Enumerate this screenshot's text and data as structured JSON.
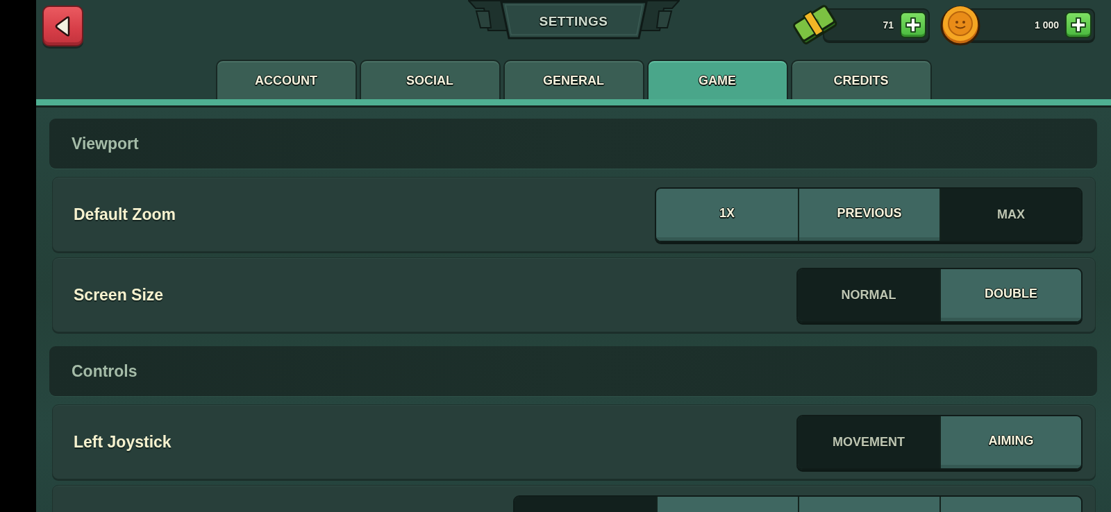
{
  "title": "SETTINGS",
  "currencies": [
    {
      "kind": "cash",
      "amount": "71"
    },
    {
      "kind": "coin",
      "amount": "1 000"
    }
  ],
  "tabs": [
    {
      "label": "ACCOUNT",
      "selected": false
    },
    {
      "label": "SOCIAL",
      "selected": false
    },
    {
      "label": "GENERAL",
      "selected": false
    },
    {
      "label": "GAME",
      "selected": true
    },
    {
      "label": "CREDITS",
      "selected": false
    }
  ],
  "sections": [
    {
      "title": "Viewport",
      "settings": [
        {
          "label": "Default Zoom",
          "options": [
            {
              "label": "1X",
              "selected": false
            },
            {
              "label": "PREVIOUS",
              "selected": false
            },
            {
              "label": "MAX",
              "selected": true
            }
          ]
        },
        {
          "label": "Screen Size",
          "options": [
            {
              "label": "NORMAL",
              "selected": true
            },
            {
              "label": "DOUBLE",
              "selected": false
            }
          ]
        }
      ]
    },
    {
      "title": "Controls",
      "settings": [
        {
          "label": "Left Joystick",
          "options": [
            {
              "label": "MOVEMENT",
              "selected": true
            },
            {
              "label": "AIMING",
              "selected": false
            }
          ]
        },
        {
          "options": [
            {
              "selected": true
            },
            {
              "selected": false
            },
            {
              "selected": false
            },
            {
              "selected": false
            }
          ]
        }
      ]
    }
  ]
}
